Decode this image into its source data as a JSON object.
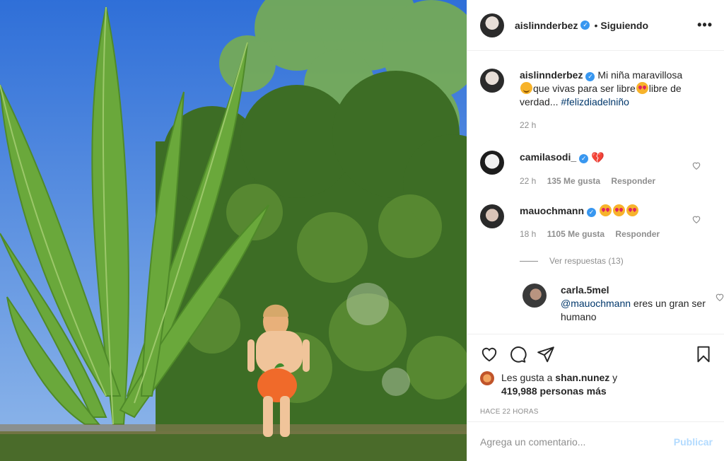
{
  "post": {
    "author": "aislinnderbez",
    "follow_sep": "•",
    "follow_status": "Siguiendo",
    "more_icon": "more-horizontal-icon",
    "verified_icon": "verified-badge-icon"
  },
  "caption": {
    "author": "aislinnderbez",
    "text_1": "Mi niña maravillosa",
    "text_2": "que vivas para ser libre",
    "text_3": "libre de verdad... ",
    "hashtag": "#felizdiadelniño",
    "time": "22 h"
  },
  "comments": [
    {
      "author": "camilasodi_",
      "text": "",
      "emoji": "broken-heart",
      "time": "22 h",
      "likes": "135 Me gusta",
      "reply": "Responder"
    },
    {
      "author": "mauochmann",
      "text": "",
      "emoji": "heart-eyes x3",
      "time": "18 h",
      "likes": "1105 Me gusta",
      "reply": "Responder"
    }
  ],
  "view_replies": "Ver respuestas (13)",
  "reply": {
    "author": "carla.5mel",
    "mention": "@mauochmann",
    "text": " eres un gran ser humano"
  },
  "actions": {
    "like_icon": "heart-icon",
    "comment_icon": "comment-icon",
    "share_icon": "send-icon",
    "save_icon": "bookmark-icon"
  },
  "likes": {
    "prefix": "Les gusta a ",
    "user": "shan.nunez",
    "conj": " y",
    "count": "419,988 personas más"
  },
  "time_ago": "HACE 22 HORAS",
  "comment_box": {
    "placeholder": "Agrega un comentario...",
    "publish": "Publicar"
  },
  "colors": {
    "accent": "#3897f0",
    "link": "#00376b",
    "publish_disabled": "#b3dbff",
    "muted": "#8e8e8e",
    "sky": "#3f7fe0"
  }
}
